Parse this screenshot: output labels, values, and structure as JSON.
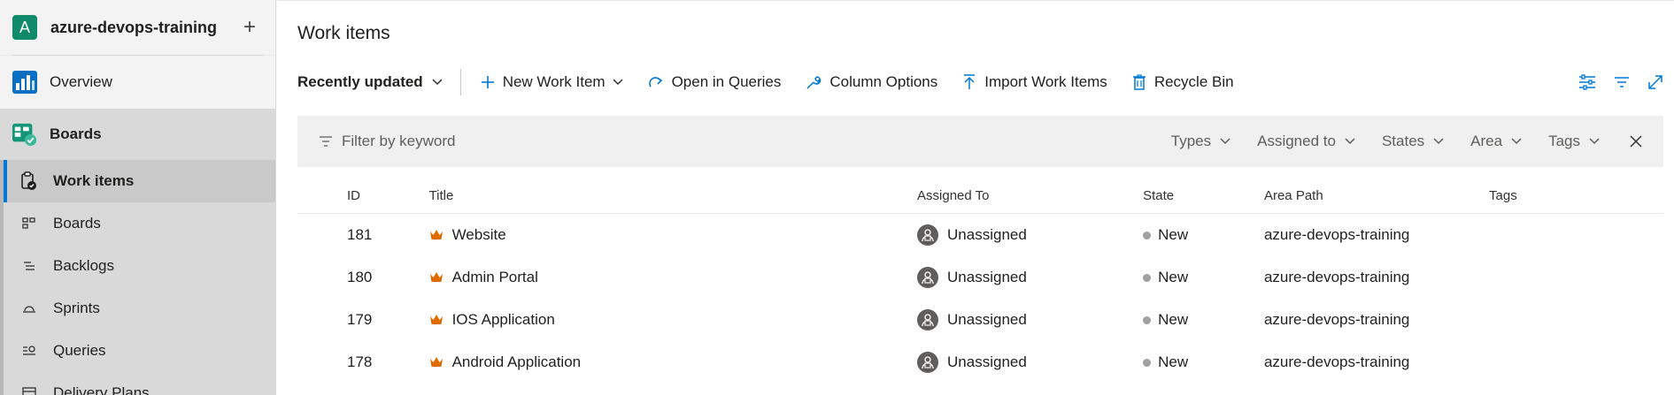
{
  "project": {
    "avatar_letter": "A",
    "name": "azure-devops-training",
    "add": "+"
  },
  "nav": {
    "overview": "Overview",
    "boards_hub": "Boards",
    "work_items": "Work items",
    "boards": "Boards",
    "backlogs": "Backlogs",
    "sprints": "Sprints",
    "queries": "Queries",
    "delivery_plans": "Delivery Plans"
  },
  "page_title": "Work items",
  "toolbar": {
    "recently_updated": "Recently updated",
    "new_work_item": "New Work Item",
    "open_in_queries": "Open in Queries",
    "column_options": "Column Options",
    "import_work_items": "Import Work Items",
    "recycle_bin": "Recycle Bin"
  },
  "filter": {
    "placeholder": "Filter by keyword",
    "types": "Types",
    "assigned_to": "Assigned to",
    "states": "States",
    "area": "Area",
    "tags": "Tags"
  },
  "columns": {
    "id": "ID",
    "title": "Title",
    "assigned_to": "Assigned To",
    "state": "State",
    "area_path": "Area Path",
    "tags": "Tags"
  },
  "rows": [
    {
      "id": "181",
      "title": "Website",
      "assigned": "Unassigned",
      "state": "New",
      "area": "azure-devops-training",
      "tags": ""
    },
    {
      "id": "180",
      "title": "Admin Portal",
      "assigned": "Unassigned",
      "state": "New",
      "area": "azure-devops-training",
      "tags": ""
    },
    {
      "id": "179",
      "title": "IOS Application",
      "assigned": "Unassigned",
      "state": "New",
      "area": "azure-devops-training",
      "tags": ""
    },
    {
      "id": "178",
      "title": "Android Application",
      "assigned": "Unassigned",
      "state": "New",
      "area": "azure-devops-training",
      "tags": ""
    }
  ],
  "colors": {
    "accent": "#0078d4",
    "project": "#108a6a",
    "epic": "#e06c00",
    "state_new": "#a19f9d"
  }
}
